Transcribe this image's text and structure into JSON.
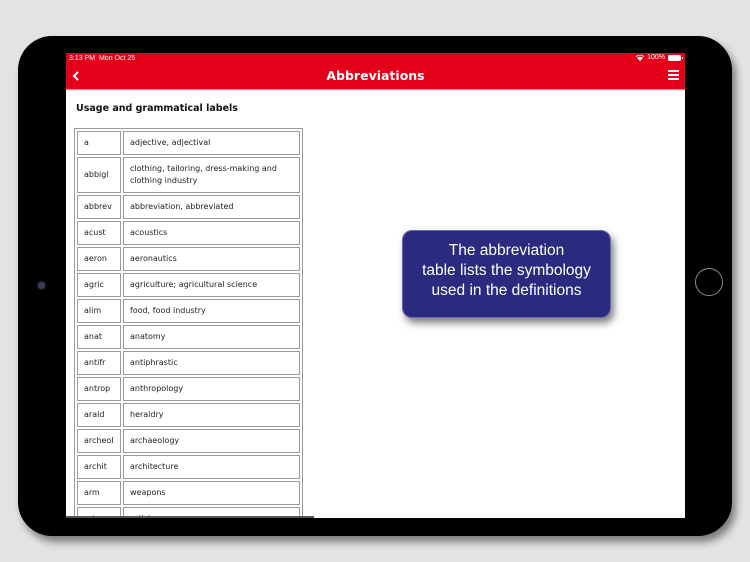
{
  "status_bar": {
    "time": "3:13 PM",
    "date": "Mon Oct 25",
    "battery": "100%",
    "wifi_icon": "wifi-icon",
    "battery_icon": "battery-icon"
  },
  "navbar": {
    "title": "Abbreviations",
    "back_icon": "chevron-left-icon",
    "menu_icon": "hamburger-menu-icon",
    "color": "#e30018"
  },
  "section": {
    "title": "Usage and grammatical labels"
  },
  "table": {
    "rows": [
      {
        "abbr": "a",
        "meaning": "adjective, adjectival"
      },
      {
        "abbr": "abbigl",
        "meaning": "clothing, tailoring, dress-making and clothing industry"
      },
      {
        "abbr": "abbrev",
        "meaning": "abbreviation, abbreviated"
      },
      {
        "abbr": "acust",
        "meaning": "acoustics"
      },
      {
        "abbr": "aeron",
        "meaning": "aeronautics"
      },
      {
        "abbr": "agric",
        "meaning": "agriculture; agricultural science"
      },
      {
        "abbr": "alim",
        "meaning": "food, food industry"
      },
      {
        "abbr": "anat",
        "meaning": "anatomy"
      },
      {
        "abbr": "antifr",
        "meaning": "antiphrastic"
      },
      {
        "abbr": "antrop",
        "meaning": "anthropology"
      },
      {
        "abbr": "arald",
        "meaning": "heraldry"
      },
      {
        "abbr": "archeol",
        "meaning": "archaeology"
      },
      {
        "abbr": "archit",
        "meaning": "architecture"
      },
      {
        "abbr": "arm",
        "meaning": "weapons"
      },
      {
        "abbr": "art",
        "meaning": "article"
      }
    ]
  },
  "callout": {
    "lines": [
      "The abbreviation",
      "table lists the symbology",
      "used in the definitions"
    ],
    "color": "#2a2a7e"
  }
}
